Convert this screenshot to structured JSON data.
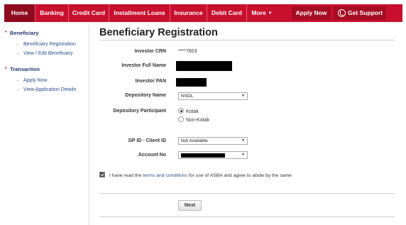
{
  "nav": {
    "items": [
      {
        "label": "Home",
        "active": true
      },
      {
        "label": "Banking"
      },
      {
        "label": "Credit Card"
      },
      {
        "label": "Installment Loans"
      },
      {
        "label": "Insurance"
      },
      {
        "label": "Debit Card"
      },
      {
        "label": "More"
      }
    ],
    "more_icon": "caret-down-icon",
    "apply_label": "Apply Now",
    "support_label": "Get Support",
    "support_icon": "phone-icon",
    "brand_color": "#c8102e"
  },
  "sidebar": {
    "sections": [
      {
        "title": "Beneficiary",
        "links": [
          "Beneficiary Registration",
          "View / Edit Beneficiary"
        ]
      },
      {
        "title": "Transaction",
        "links": [
          "Apply Now",
          "View Application Details"
        ]
      }
    ],
    "link_arrow": "→"
  },
  "main": {
    "title": "Beneficiary Registration",
    "fields": {
      "crn_label": "Investor CRN",
      "crn_value": "****7603",
      "name_label": "Investor Full Name",
      "pan_label": "Investor PAN",
      "depository_label": "Depository Name",
      "depository_value": "NSDL",
      "participant_label": "Depository Participant",
      "participant_options": [
        "Kotak",
        "Non-Kotak"
      ],
      "participant_selected": "Kotak",
      "dpid_label": "DP ID - Client ID",
      "dpid_value": "Not Available",
      "account_label": "Account No"
    },
    "terms": {
      "checked": true,
      "prefix": "I have read the ",
      "link": "terms and conditions",
      "suffix": " for use of ASBA and agree to abide by the same"
    },
    "next_label": "Next"
  }
}
